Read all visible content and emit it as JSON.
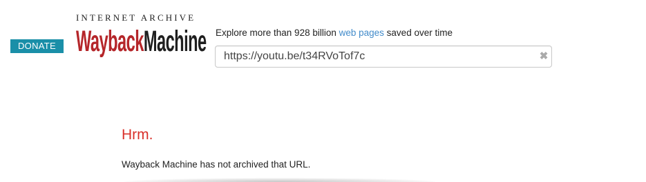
{
  "header": {
    "donate_label": "DONATE",
    "logo_top": "INTERNET ARCHIVE",
    "logo_way": "Wayback",
    "logo_machine": "Machine",
    "explore_prefix": "Explore more than 928 billion ",
    "explore_link": "web pages",
    "explore_suffix": " saved over time"
  },
  "search": {
    "value": "https://youtu.be/t34RVoTof7c",
    "clear_glyph": "✖"
  },
  "error": {
    "title": "Hrm.",
    "message": "Wayback Machine has not archived that URL."
  },
  "colors": {
    "donate_bg": "#1a8fa8",
    "logo_red": "#b5262a",
    "link": "#428bca",
    "error_red": "#d9302a"
  }
}
